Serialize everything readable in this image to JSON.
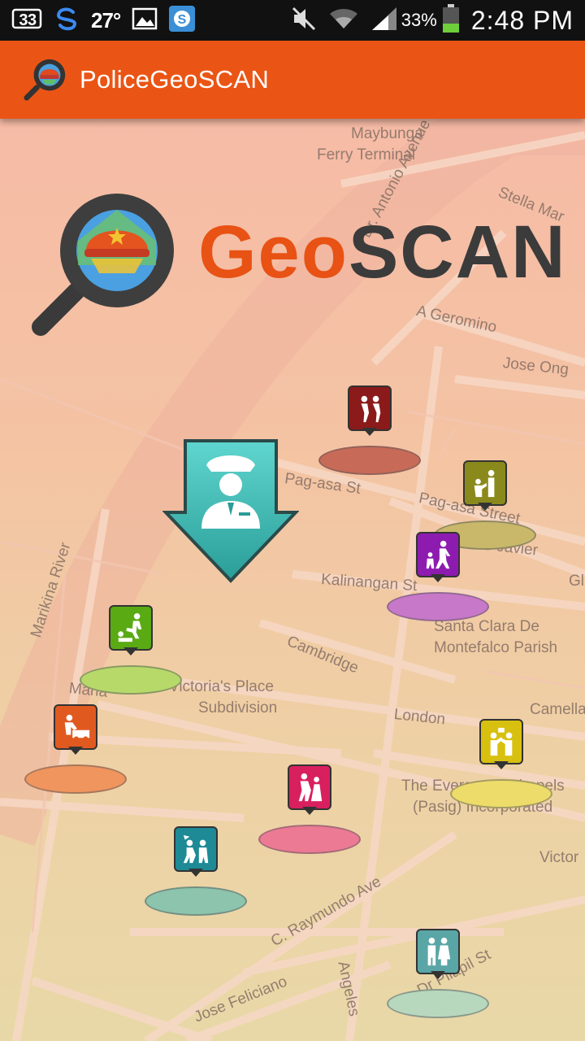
{
  "status_bar": {
    "badge": "33",
    "temperature": "27°",
    "battery_percent": "33%",
    "time": "2:48 PM",
    "icons": [
      "notification-badge-icon",
      "sync-icon",
      "gallery-icon",
      "skype-icon",
      "mute-icon",
      "wifi-icon",
      "signal-icon",
      "battery-icon"
    ]
  },
  "app_bar": {
    "title": "PoliceGeoSCAN",
    "color": "#ea5515"
  },
  "logo": {
    "text_geo": "Geo",
    "text_scan": "SCAN"
  },
  "map": {
    "labels": [
      {
        "text": "Maybunga"
      },
      {
        "text": "Ferry Terminal"
      },
      {
        "text": "Dr. Antonio Avenue"
      },
      {
        "text": "Stella Mar"
      },
      {
        "text": "A Geromino"
      },
      {
        "text": "Jose Ong"
      },
      {
        "text": "Pag-asa St"
      },
      {
        "text": "Pag-asa Street"
      },
      {
        "text": "J B Javier"
      },
      {
        "text": "Kalinangan St"
      },
      {
        "text": "Gl"
      },
      {
        "text": "Santa Clara De"
      },
      {
        "text": "Montefalco Parish"
      },
      {
        "text": "Marikina River"
      },
      {
        "text": "Cambridge"
      },
      {
        "text": "Victoria's Place"
      },
      {
        "text": "Subdivision"
      },
      {
        "text": "Maria"
      },
      {
        "text": "London"
      },
      {
        "text": "Camella"
      },
      {
        "text": "The Evergreen Chapels"
      },
      {
        "text": "(Pasig) Incorporated"
      },
      {
        "text": "Victor"
      },
      {
        "text": "C. Raymundo Ave"
      },
      {
        "text": "Jose Feliciano"
      },
      {
        "text": "Angeles"
      },
      {
        "text": "Dr Pilapil St"
      }
    ]
  },
  "markers": [
    {
      "name": "marker-crime-darkred",
      "pin_color": "#8b1a1a",
      "pad_color": "#c86a58",
      "icon": "two-people-icon"
    },
    {
      "name": "marker-crime-olive",
      "pin_color": "#8a8a1c",
      "pad_color": "#c9b86a",
      "icon": "person-robbery-icon"
    },
    {
      "name": "marker-crime-purple",
      "pin_color": "#8e1bb0",
      "pad_color": "#c878c8",
      "icon": "person-chase-icon"
    },
    {
      "name": "marker-crime-green",
      "pin_color": "#5aaa14",
      "pad_color": "#b7d96a",
      "icon": "assault-icon"
    },
    {
      "name": "marker-crime-orange",
      "pin_color": "#e05a20",
      "pad_color": "#f0955e",
      "icon": "car-accident-icon"
    },
    {
      "name": "marker-crime-yellow",
      "pin_color": "#d8c010",
      "pad_color": "#eedc6a",
      "icon": "fight-icon"
    },
    {
      "name": "marker-crime-pink",
      "pin_color": "#d8205e",
      "pad_color": "#ec7a94",
      "icon": "theft-icon"
    },
    {
      "name": "marker-crime-teal",
      "pin_color": "#1d8a96",
      "pad_color": "#8cc4ad",
      "icon": "harassment-icon"
    },
    {
      "name": "marker-crime-lightteal",
      "pin_color": "#5aa6a6",
      "pad_color": "#b8d8be",
      "icon": "family-icon"
    }
  ],
  "police_marker": {
    "color": "#3bbcb4",
    "icon": "police-officer-icon"
  }
}
